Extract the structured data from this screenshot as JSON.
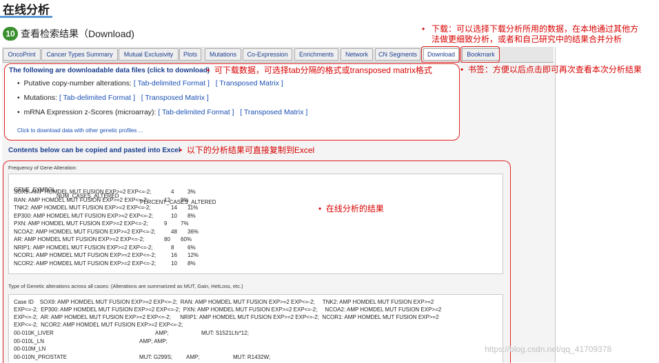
{
  "header": {
    "title": "在线分析"
  },
  "step": {
    "number": "10",
    "title": "查看检索结果（Download)"
  },
  "tabs": [
    "OncoPrint",
    "Cancer Types Summary",
    "Mutual Exclusivity",
    "Plots",
    "Mutations",
    "Co-Expression",
    "Enrichments",
    "Network",
    "CN Segments",
    "Download",
    "Bookmark"
  ],
  "annotations": {
    "bullet": "•",
    "download": "下载：可以选择下载分析所用的数据，在本地通过其他方法做更细致分析，或者和自己研究中的结果合并分析",
    "download_line1": "下载：可以选择下载分析所用的数据，在本地通过其他方",
    "download_line2": "法做更细致分析，或者和自己研究中的结果合并分析",
    "bookmark": "书签：方便以后点击即可再次查看本次分析结果",
    "dl_data": "可下载数据，可选择tab分隔的格式或transposed matrix格式",
    "excel": "以下的分析结果可直接复制到Excel",
    "results": "在线分析的结果"
  },
  "download_box": {
    "heading": "The following are downloadable data files (click to download)",
    "items": [
      {
        "label": "Putative copy-number alterations:",
        "tab": "[ Tab-delimited Format ]",
        "transposed": "[ Transposed Matrix ]"
      },
      {
        "label": "Mutations:",
        "tab": "[ Tab-delimited Format ]",
        "transposed": "[ Transposed Matrix ]"
      },
      {
        "label": "mRNA Expression z-Scores (microarray):",
        "tab": "[ Tab-delimited Format ]",
        "transposed": "[ Transposed Matrix ]"
      }
    ],
    "more_link": "Click to download data with other genetic profiles ..."
  },
  "copy_heading": "Contents below can be copied and pasted into Excel",
  "frequency": {
    "label": "Frequency of Gene Alteration:",
    "columns": [
      "GENE_SYMBOL",
      "NUM_CASES_ALTERED",
      "PERCENT_CASES_ALTERED"
    ],
    "rows": [
      {
        "gene": "SOX9: AMP HOMDEL MUT FUSION EXP>=2 EXP<=-2;",
        "num": "4",
        "pct": "3%"
      },
      {
        "gene": "RAN: AMP HOMDEL MUT FUSION EXP>=2 EXP<=-2;",
        "num": "12",
        "pct": "9%"
      },
      {
        "gene": "TNK2: AMP HOMDEL MUT FUSION EXP>=2 EXP<=-2;",
        "num": "14",
        "pct": "11%"
      },
      {
        "gene": "EP300: AMP HOMDEL MUT FUSION EXP>=2 EXP<=-2;",
        "num": "10",
        "pct": "8%"
      },
      {
        "gene": "PXN: AMP HOMDEL MUT FUSION EXP>=2 EXP<=-2;",
        "num": "9",
        "pct": "7%"
      },
      {
        "gene": "NCOA2: AMP HOMDEL MUT FUSION EXP>=2 EXP<=-2;",
        "num": "48",
        "pct": "36%"
      },
      {
        "gene": "AR: AMP HOMDEL MUT FUSION EXP>=2 EXP<=-2;",
        "num": "80",
        "pct": "60%"
      },
      {
        "gene": "NRIP1: AMP HOMDEL MUT FUSION EXP>=2 EXP<=-2;",
        "num": "8",
        "pct": "6%"
      },
      {
        "gene": "NCOR1: AMP HOMDEL MUT FUSION EXP>=2 EXP<=-2;",
        "num": "16",
        "pct": "12%"
      },
      {
        "gene": "NCOR2: AMP HOMDEL MUT FUSION EXP>=2 EXP<=-2;",
        "num": "10",
        "pct": "8%"
      }
    ]
  },
  "genetic_types": {
    "label": "Type of Genetic alterations across all cases: (Alterations are summarized as MUT, Gain, HetLoss, etc.)",
    "header_lines": [
      "Case ID    SOX9: AMP HOMDEL MUT FUSION EXP>=2 EXP<=-2;  RAN: AMP HOMDEL MUT FUSION EXP>=2 EXP<=-2;     TNK2: AMP HOMDEL MUT FUSION EXP>=2",
      "EXP<=-2;  EP300: AMP HOMDEL MUT FUSION EXP>=2 EXP<=-2;  PXN: AMP HOMDEL MUT FUSION EXP>=2 EXP<=-2;     NCOA2: AMP HOMDEL MUT FUSION EXP>=2",
      "EXP<=-2;  AR: AMP HOMDEL MUT FUSION EXP>=2 EXP<=-2;      NRIP1: AMP HOMDEL MUT FUSION EXP>=2 EXP<=-2;  NCOR1: AMP HOMDEL MUT FUSION EXP>=2",
      "EXP<=-2;  NCOR2: AMP HOMDEL MUT FUSION EXP>=2 EXP<=-2;"
    ],
    "rows": [
      {
        "case": "00-010K_LIVER",
        "c1": "AMP;",
        "c2": "MUT: S1521Lfs*12;",
        "c3": ""
      },
      {
        "case": "00-010L_LN",
        "c1": "AMP; AMP;",
        "c2": "",
        "c3": ""
      },
      {
        "case": "00-010M_LN",
        "c1": "",
        "c2": "",
        "c3": ""
      },
      {
        "case": "00-010N_PROSTATE",
        "c1": "MUT: G299S;",
        "c2": "AMP;",
        "c3": "MUT: R1432W;"
      }
    ]
  },
  "watermark": "https://blog.csdn.net/qq_41709378",
  "colors": {
    "accent_red": "#e02020",
    "link_blue": "#1a4fb3",
    "step_green": "#3a8f2e"
  }
}
